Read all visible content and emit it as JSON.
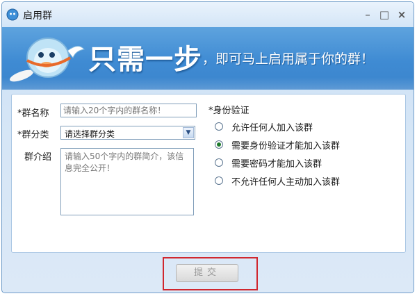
{
  "window": {
    "title": "启用群",
    "buttons": {
      "minimize": "–",
      "maximize": "□",
      "close": "×"
    }
  },
  "banner": {
    "slogan_main": "只需一步",
    "slogan_sub": "，即可马上启用属于你的群！"
  },
  "form": {
    "name_label": "*群名称",
    "name_placeholder": "请输入20个字内的群名称！",
    "category_label": "*群分类",
    "category_value": "请选择群分类",
    "intro_label": "群介绍",
    "intro_placeholder": "请输入50个字内的群简介，该信息完全公开！",
    "auth_label": "*身份验证",
    "auth_options": [
      {
        "label": "允许任何人加入该群",
        "checked": false
      },
      {
        "label": "需要身份验证才能加入该群",
        "checked": true
      },
      {
        "label": "需要密码才能加入该群",
        "checked": false
      },
      {
        "label": "不允许任何人主动加入该群",
        "checked": false
      }
    ]
  },
  "submit_label": "提交",
  "colors": {
    "banner": "#3f8bd3",
    "highlight": "#d0272f",
    "radio_checked": "#1d7a2c"
  }
}
